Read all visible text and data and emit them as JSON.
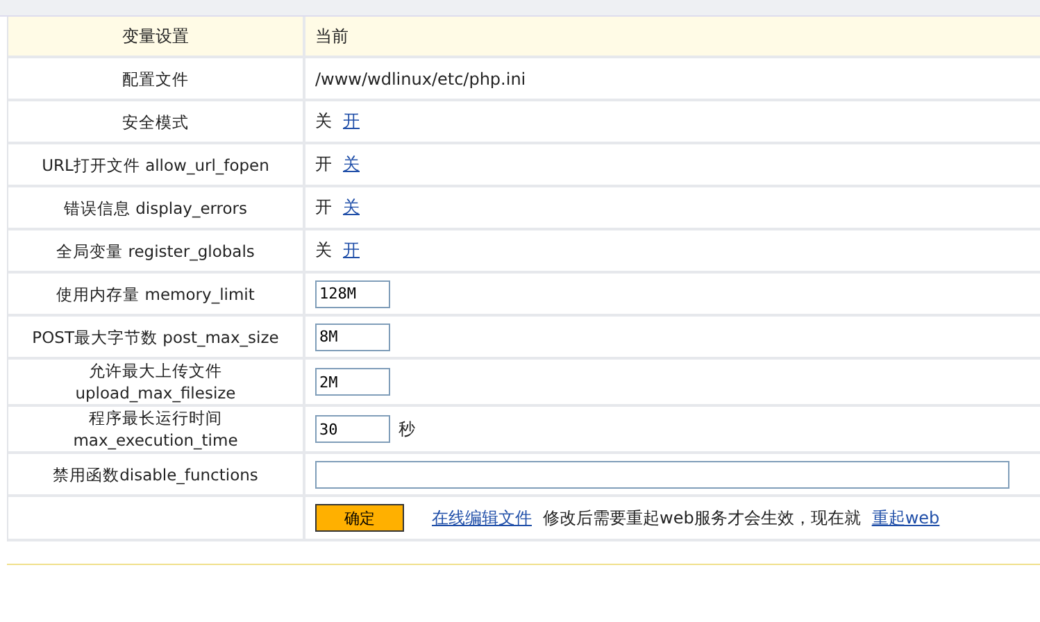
{
  "header": {
    "label": "变量设置",
    "value": "当前"
  },
  "rows": [
    {
      "kind": "text",
      "label": "配置文件",
      "value": "/www/wdlinux/etc/php.ini"
    },
    {
      "kind": "toggle",
      "label": "安全模式",
      "value": "关",
      "link": "开"
    },
    {
      "kind": "toggle",
      "label": "URL打开文件 allow_url_fopen",
      "value": "开",
      "link": "关"
    },
    {
      "kind": "toggle",
      "label": "错误信息 display_errors",
      "value": "开",
      "link": "关"
    },
    {
      "kind": "toggle",
      "label": "全局变量 register_globals",
      "value": "关",
      "link": "开"
    },
    {
      "kind": "input",
      "label": "使用内存量 memory_limit",
      "value": "128M"
    },
    {
      "kind": "input",
      "label": "POST最大字节数 post_max_size",
      "value": "8M"
    },
    {
      "kind": "input",
      "label": "允许最大上传文件 upload_max_filesize",
      "value": "2M"
    },
    {
      "kind": "input",
      "label": "程序最长运行时间 max_execution_time",
      "value": "30",
      "unit": "秒"
    },
    {
      "kind": "wide_input",
      "label": "禁用函数disable_functions"
    }
  ],
  "footer": {
    "button": "确定",
    "edit_link": "在线编辑文件",
    "note": "修改后需要重起web服务才会生效，现在就",
    "restart_link": "重起web"
  }
}
